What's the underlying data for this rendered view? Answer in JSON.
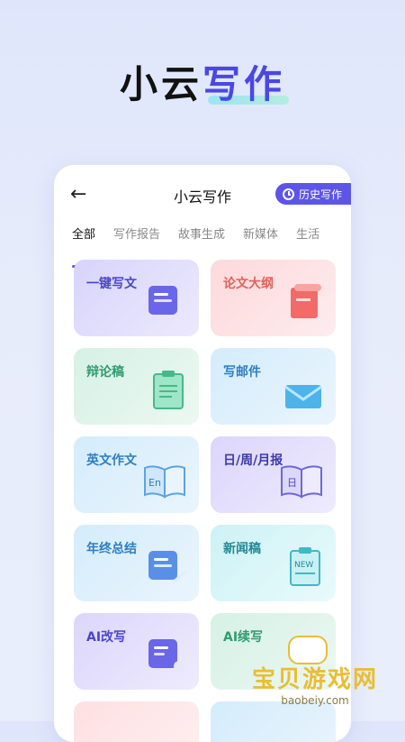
{
  "hero": {
    "title_plain": "小云",
    "title_accent": "写作"
  },
  "nav": {
    "title": "小云写作",
    "history_label": "历史写作"
  },
  "tabs": [
    {
      "label": "全部"
    },
    {
      "label": "写作报告"
    },
    {
      "label": "故事生成"
    },
    {
      "label": "新媒体"
    },
    {
      "label": "生活"
    }
  ],
  "cards": [
    {
      "label": "一键写文",
      "color": "#4a47c8"
    },
    {
      "label": "论文大纲",
      "color": "#e0625a"
    },
    {
      "label": "辩论稿",
      "color": "#2f9c6f"
    },
    {
      "label": "写邮件",
      "color": "#2f7fc1"
    },
    {
      "label": "英文作文",
      "color": "#2f7fc1"
    },
    {
      "label": "日/周/月报",
      "color": "#3c3aa8"
    },
    {
      "label": "年终总结",
      "color": "#2f7fc1"
    },
    {
      "label": "新闻稿",
      "color": "#208a99"
    },
    {
      "label": "AI改写",
      "color": "#4a47c8"
    },
    {
      "label": "AI续写",
      "color": "#2f9c6f"
    }
  ],
  "icons": {
    "en_text": "En",
    "day_text": "日",
    "new_text": "NEW"
  },
  "watermark": {
    "title": "宝贝游戏网",
    "url": "baobeiy.com"
  }
}
